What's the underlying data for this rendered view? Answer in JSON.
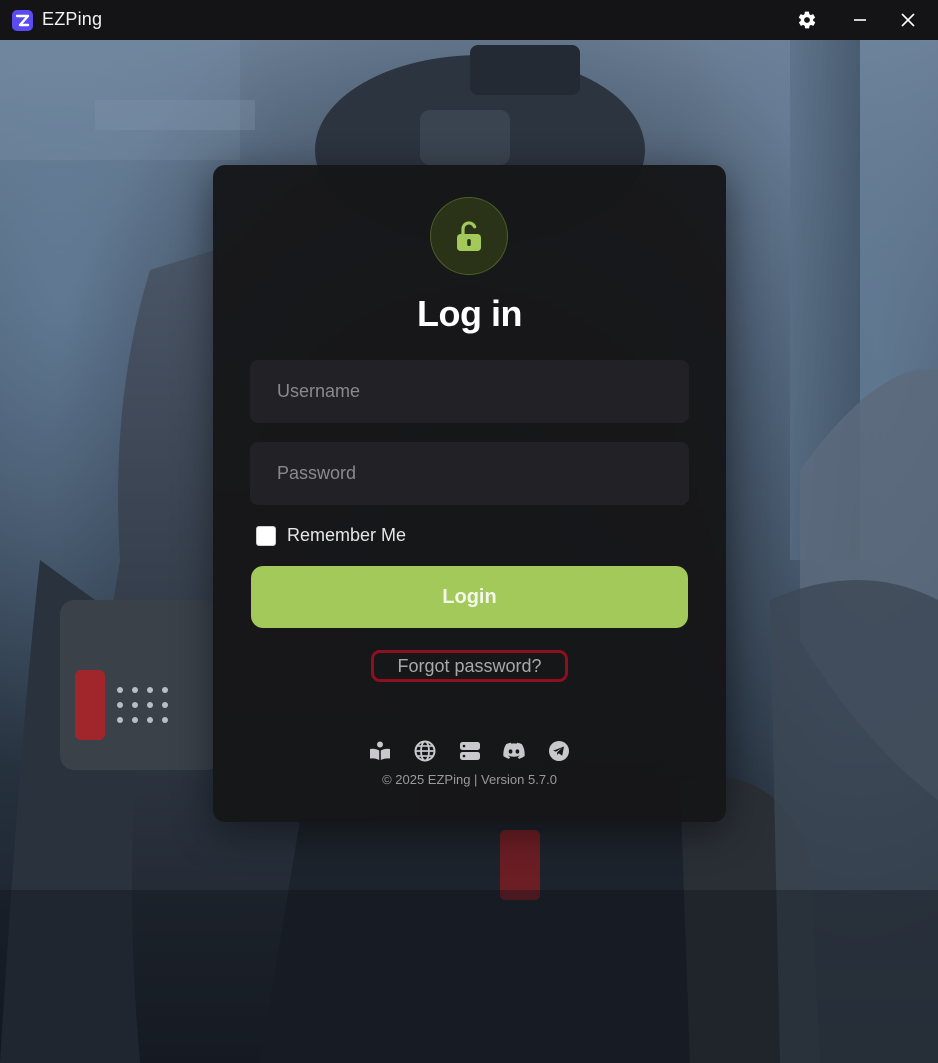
{
  "window": {
    "title": "EZPing"
  },
  "titlebar": {
    "icons": [
      "ezping-logo-icon",
      "gear-icon",
      "minimize-icon",
      "close-icon"
    ]
  },
  "login": {
    "heading": "Log in",
    "username_placeholder": "Username",
    "password_placeholder": "Password",
    "remember_label": "Remember Me",
    "remember_checked": false,
    "login_button": "Login",
    "forgot_link": "Forgot password?",
    "footer_icons": [
      "book-icon",
      "globe-icon",
      "server-icon",
      "discord-icon",
      "telegram-icon"
    ],
    "footer": "© 2025 EZPing | Version 5.7.0"
  },
  "colors": {
    "accent": "#a3c95a",
    "card_bg": "#161618",
    "field_bg": "#222226",
    "logo_purple": "#5a4cf0",
    "highlight_red": "#8e0f1f"
  }
}
